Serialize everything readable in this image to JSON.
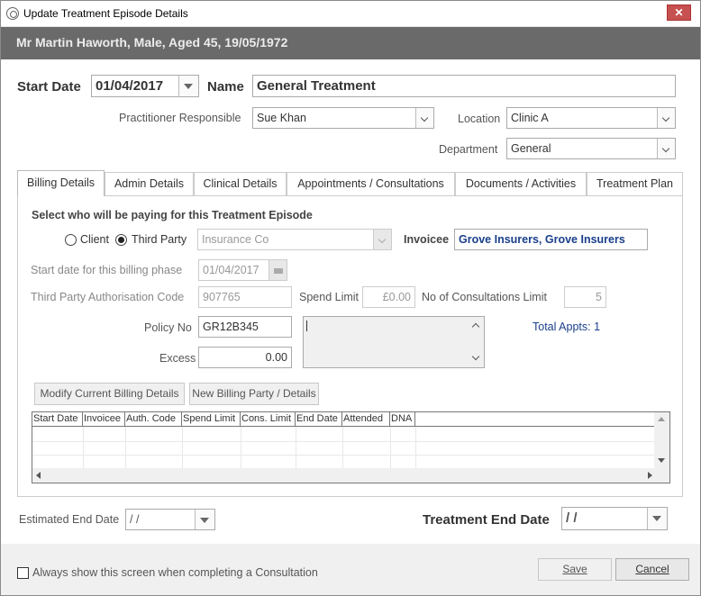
{
  "window": {
    "title": "Update Treatment Episode Details",
    "close_label": "✕"
  },
  "patient_header": "Mr Martin Haworth, Male, Aged 45, 19/05/1972",
  "form": {
    "start_date_label": "Start Date",
    "start_date_value": "01/04/2017",
    "name_label": "Name",
    "name_value": "General Treatment",
    "practitioner_label": "Practitioner Responsible",
    "practitioner_value": "Sue Khan",
    "location_label": "Location",
    "location_value": "Clinic A",
    "department_label": "Department",
    "department_value": "General"
  },
  "tabs": [
    {
      "label": "Billing Details",
      "active": true
    },
    {
      "label": "Admin Details"
    },
    {
      "label": "Clinical Details"
    },
    {
      "label": "Appointments / Consultations"
    },
    {
      "label": "Documents / Activities"
    },
    {
      "label": "Treatment Plan"
    }
  ],
  "billing": {
    "section_title": "Select who will be paying for this Treatment Episode",
    "client_label": "Client",
    "third_party_label": "Third Party",
    "payer_selected": "Third Party",
    "insurer_value": "Insurance Co",
    "invoicee_label": "Invoicee",
    "invoicee_value": "Grove Insurers, Grove Insurers",
    "phase_start_label": "Start date for this billing phase",
    "phase_start_value": "01/04/2017",
    "auth_code_label": "Third Party Authorisation Code",
    "auth_code_value": "907765",
    "spend_limit_label": "Spend Limit",
    "spend_limit_value": "£0.00",
    "consult_limit_label": "No of Consultations Limit",
    "consult_limit_value": "5",
    "policy_label": "Policy No",
    "policy_value": "GR12B345",
    "total_appts": "Total Appts: 1",
    "excess_label": "Excess",
    "excess_value": "0.00",
    "modify_button": "Modify Current Billing Details",
    "new_party_button": "New Billing Party / Details",
    "grid_columns": [
      "Start Date",
      "Invoicee",
      "Auth. Code",
      "Spend Limit",
      "Cons. Limit",
      "End Date",
      "Attended",
      "DNA"
    ]
  },
  "bottom": {
    "est_end_label": "Estimated End Date",
    "est_end_value": " /  /",
    "treat_end_label": "Treatment End Date",
    "treat_end_value": " /  /"
  },
  "footer": {
    "always_show_label": "Always show this screen when completing a Consultation",
    "save_label": "Save",
    "cancel_label": "Cancel"
  },
  "colors": {
    "header_band": "#6a6a6a",
    "close_button": "#c75050",
    "link_blue": "#1a3f8a"
  }
}
